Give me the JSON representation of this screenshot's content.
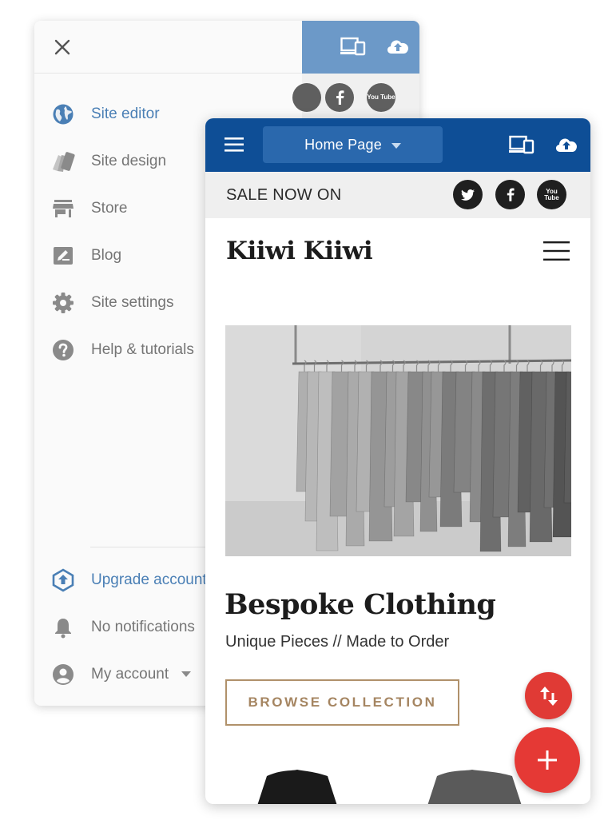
{
  "side_menu": {
    "items": [
      {
        "label": "Site editor",
        "icon": "globe-icon",
        "active": true
      },
      {
        "label": "Site design",
        "icon": "swatch-icon"
      },
      {
        "label": "Store",
        "icon": "store-icon"
      },
      {
        "label": "Blog",
        "icon": "blog-icon"
      },
      {
        "label": "Site settings",
        "icon": "gear-icon"
      },
      {
        "label": "Help & tutorials",
        "icon": "help-icon"
      }
    ],
    "footer": [
      {
        "label": "Upgrade account",
        "icon": "upgrade-icon"
      },
      {
        "label": "No notifications",
        "icon": "bell-icon"
      },
      {
        "label": "My account",
        "icon": "account-icon"
      }
    ]
  },
  "editor": {
    "page_selector": "Home Page"
  },
  "site": {
    "sale_banner": "SALE NOW ON",
    "social": [
      "twitter-icon",
      "facebook-icon",
      "youtube-icon"
    ],
    "youtube_text": "You Tube",
    "brand": "Kiiwi Kiiwi",
    "hero_title": "Bespoke Clothing",
    "hero_subtitle": "Unique Pieces // Made to Order",
    "cta": "BROWSE COLLECTION"
  },
  "colors": {
    "toolbar": "#0e4e96",
    "toolbar_faded": "#6c99c8",
    "accent_link": "#4a7fb5",
    "cta_border": "#b0916a",
    "fab": "#e53935"
  }
}
